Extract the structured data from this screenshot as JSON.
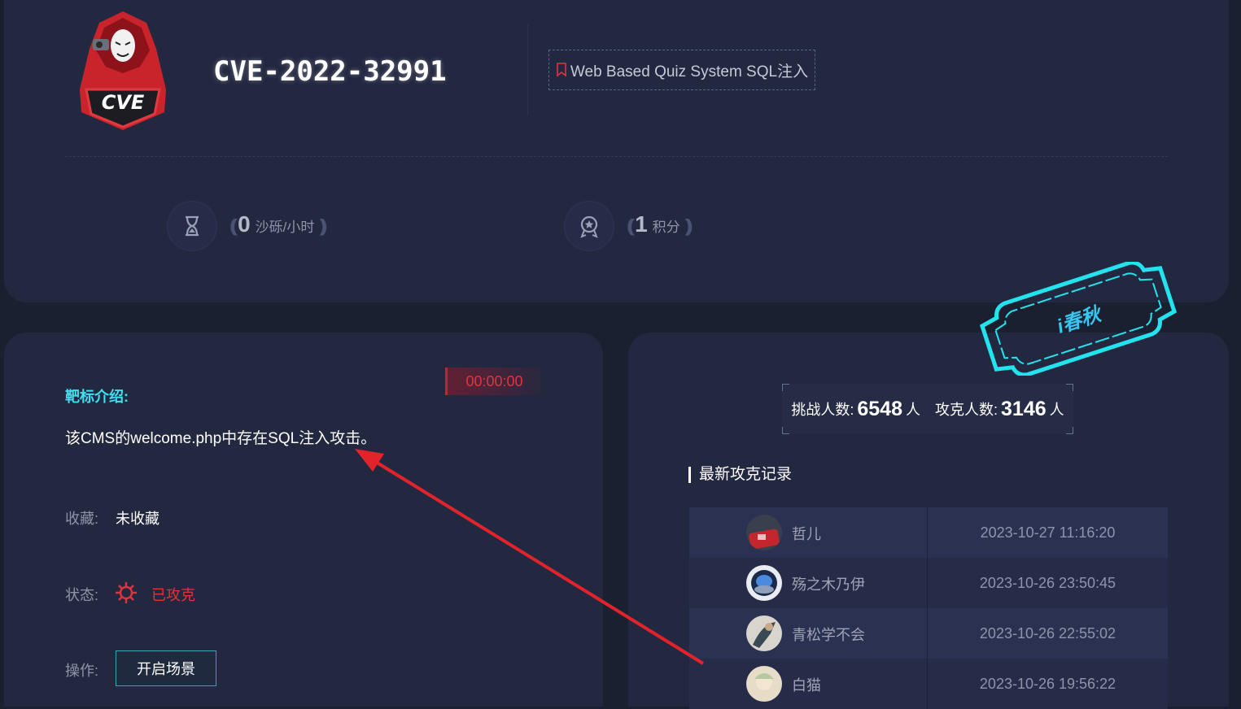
{
  "header": {
    "logo_text": "CVE",
    "cve_id": "CVE-2022-32991",
    "vuln_name": "Web Based Quiz System SQL注入"
  },
  "stats": {
    "sand": {
      "value": "0",
      "unit": "沙砾/小时"
    },
    "points": {
      "value": "1",
      "unit": "积分"
    }
  },
  "target": {
    "intro_label": "靶标介绍:",
    "description": "该CMS的welcome.php中存在SQL注入攻击。",
    "timer": "00:00:00",
    "favorite_label": "收藏:",
    "favorite_value": "未收藏",
    "status_label": "状态:",
    "status_value": "已攻克",
    "action_label": "操作:",
    "start_button": "开启场景"
  },
  "challenge": {
    "stamp_text": "i春秋",
    "challengers_label": "挑战人数:",
    "challengers_count": "6548",
    "challengers_unit": "人",
    "solvers_label": "攻克人数:",
    "solvers_count": "3146",
    "solvers_unit": "人",
    "records_title": "最新攻克记录",
    "records": [
      {
        "user": "哲儿",
        "time": "2023-10-27 11:16:20"
      },
      {
        "user": "殇之木乃伊",
        "time": "2023-10-26 23:50:45"
      },
      {
        "user": "青松学不会",
        "time": "2023-10-26 22:55:02"
      },
      {
        "user": "白猫",
        "time": "2023-10-26 19:56:22"
      }
    ]
  },
  "colors": {
    "accent_cyan": "#3ee0f0",
    "danger_red": "#e2333d",
    "panel_bg": "#232841",
    "page_bg": "#1b2031"
  }
}
